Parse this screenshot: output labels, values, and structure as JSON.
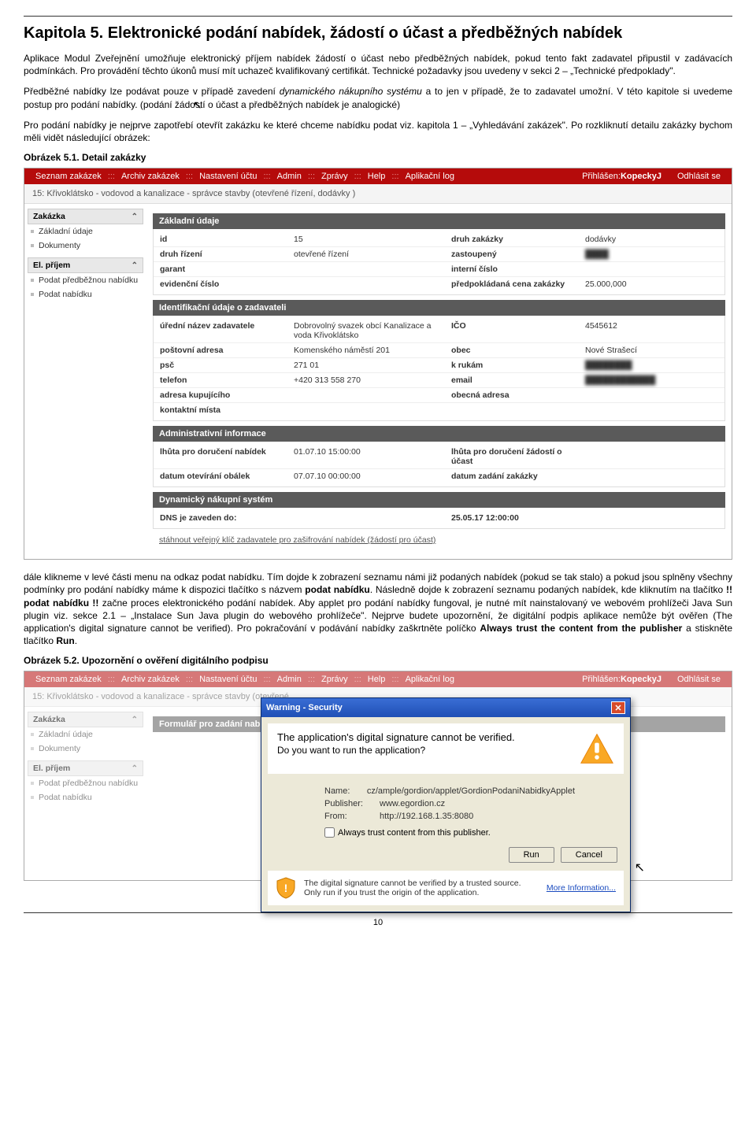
{
  "heading": "Kapitola 5. Elektronické podání nabídek, žádostí o účast a předběžných nabídek",
  "para1": "Aplikace Modul Zveřejnění umožňuje elektronický příjem nabídek žádostí o účast nebo předběžných nabídek, pokud tento fakt zadavatel připustil v zadávacích podmínkách. Pro provádění těchto úkonů musí mít uchazeč kvalifikovaný certifikát. Technické požadavky jsou uvedeny v sekci 2 – „Technické předpoklady\".",
  "para2_a": "Předběžné nabídky lze podávat pouze v případě zavedení ",
  "para2_i": "dynamického nákupního systému",
  "para2_b": " a to jen v případě, že to zadavatel umožní. V této kapitole si uvedeme postup pro podání nabídky. (podání žádostí o účast a předběžných nabídek je analogické)",
  "para3": "Pro podání nabídky je nejprve zapotřebí otevřít zakázku ke které chceme nabídku podat viz. kapitola 1 – „Vyhledávání zakázek\". Po rozkliknutí detailu zakázky bychom měli vidět následující obrázek:",
  "fig1_caption": "Obrázek 5.1. Detail zakázky",
  "para4_a": "dále klikneme v levé části menu na odkaz podat nabídku. Tím dojde k zobrazení seznamu námi již podaných nabídek (pokud se tak stalo) a pokud jsou splněny všechny podmínky pro podání nabídky máme k dispozici tlačítko s názvem ",
  "para4_b1": "podat nabídku",
  "para4_c": ". Následně dojde k zobrazení seznamu podaných nabídek, kde kliknutím na tlačítko ",
  "para4_b2": "!! podat nabídku !!",
  "para4_d": " začne proces elektronického podání nabídek. Aby applet pro podání nabídky fungoval, je nutné mít nainstalovaný ve webovém prohlížeči Java Sun plugin viz. sekce 2.1 – „Instalace Sun Java plugin do webového prohlížeče\". Nejprve budete upozornění, že digitální podpis aplikace nemůže být ověřen (The application's digital signature cannot be verified). Pro pokračování v podávání nabídky zaškrtněte políčko ",
  "para4_b3": "Always trust the content from the publisher",
  "para4_e": " a stiskněte tlačítko ",
  "para4_b4": "Run",
  "para4_f": ".",
  "fig2_caption": "Obrázek 5.2. Upozornění o ověření digitálního podpisu",
  "page_number": "10",
  "app": {
    "menu": [
      "Seznam zakázek",
      "Archiv zakázek",
      "Nastavení účtu",
      "Admin",
      "Zprávy",
      "Help",
      "Aplikační log"
    ],
    "login_label": "Přihlášen: ",
    "login_user": "KopeckyJ",
    "logout": "Odhlásit se",
    "subtitle": "15: Křivoklátsko - vodovod a kanalizace - správce stavby (otevřené řízení, dodávky )",
    "sidebar": {
      "s1_title": "Zakázka",
      "s1_items": [
        "Základní údaje",
        "Dokumenty"
      ],
      "s2_title": "El. příjem",
      "s2_items": [
        "Podat předběžnou nabídku",
        "Podat nabídku"
      ]
    },
    "panel1": {
      "title": "Základní údaje",
      "rows": [
        {
          "k": "id",
          "v": "15",
          "k2": "druh zakázky",
          "v2": "dodávky"
        },
        {
          "k": "druh řízení",
          "v": "otevřené řízení",
          "k2": "zastoupený",
          "v2": "blurred"
        },
        {
          "k": "garant",
          "v": "",
          "k2": "interní číslo",
          "v2": ""
        },
        {
          "k": "evidenční číslo",
          "v": "",
          "k2": "předpokládaná cena zakázky",
          "v2": "25.000,000"
        }
      ]
    },
    "panel2": {
      "title": "Identifikační údaje o zadavateli",
      "rows": [
        {
          "k": "úřední název zadavatele",
          "v": "Dobrovolný svazek obcí Kanalizace a voda Křivoklátsko",
          "k2": "IČO",
          "v2": "4545612"
        },
        {
          "k": "poštovní adresa",
          "v": "Komenského náměstí 201",
          "k2": "obec",
          "v2": "Nové Strašecí"
        },
        {
          "k": "psč",
          "v": "271 01",
          "k2": "k rukám",
          "v2": "blurred"
        },
        {
          "k": "telefon",
          "v": "+420 313 558 270",
          "k2": "email",
          "v2": "blurred"
        },
        {
          "k": "adresa kupujícího",
          "v": "",
          "k2": "obecná adresa",
          "v2": ""
        },
        {
          "k": "kontaktní místa",
          "v": "",
          "k2": "",
          "v2": ""
        }
      ]
    },
    "panel3": {
      "title": "Administrativní informace",
      "rows": [
        {
          "k": "lhůta pro doručení nabídek",
          "v": "01.07.10 15:00:00",
          "k2": "lhůta pro doručení žádostí o účast",
          "v2": ""
        },
        {
          "k": "datum otevírání obálek",
          "v": "07.07.10 00:00:00",
          "k2": "datum zadání zakázky",
          "v2": ""
        }
      ]
    },
    "panel4": {
      "title": "Dynamický nákupní systém",
      "rows": [
        {
          "k": "DNS je zaveden do:",
          "v": "",
          "k2": "25.05.17 12:00:00",
          "v2": ""
        }
      ]
    },
    "download": "stáhnout veřejný klíč zadavatele pro zašifrování nabídek (žádostí pro účast)"
  },
  "app2": {
    "subtitle": "15: Křivoklátsko - vodovod a kanalizace - správce stavby (otevřené",
    "main_label": "Formulář pro zadání nabídl",
    "sidebar": {
      "s1_title": "Zakázka",
      "s1_items": [
        "Základní údaje",
        "Dokumenty"
      ],
      "s2_title": "El. příjem",
      "s2_items": [
        "Podat předběžnou nabídku",
        "Podat nabídku"
      ]
    }
  },
  "dialog": {
    "title": "Warning - Security",
    "line1": "The application's digital signature cannot be verified.",
    "line2": "Do you want to run the application?",
    "name_lbl": "Name:",
    "name_val": "cz/ample/gordion/applet/GordionPodaniNabidkyApplet",
    "pub_lbl": "Publisher:",
    "pub_val": "www.egordion.cz",
    "from_lbl": "From:",
    "from_val": "http://192.168.1.35:8080",
    "checkbox": "Always trust content from this publisher.",
    "run": "Run",
    "cancel": "Cancel",
    "footer": "The digital signature cannot be verified by a trusted source. Only run if you trust the origin of the application.",
    "more": "More Information..."
  }
}
